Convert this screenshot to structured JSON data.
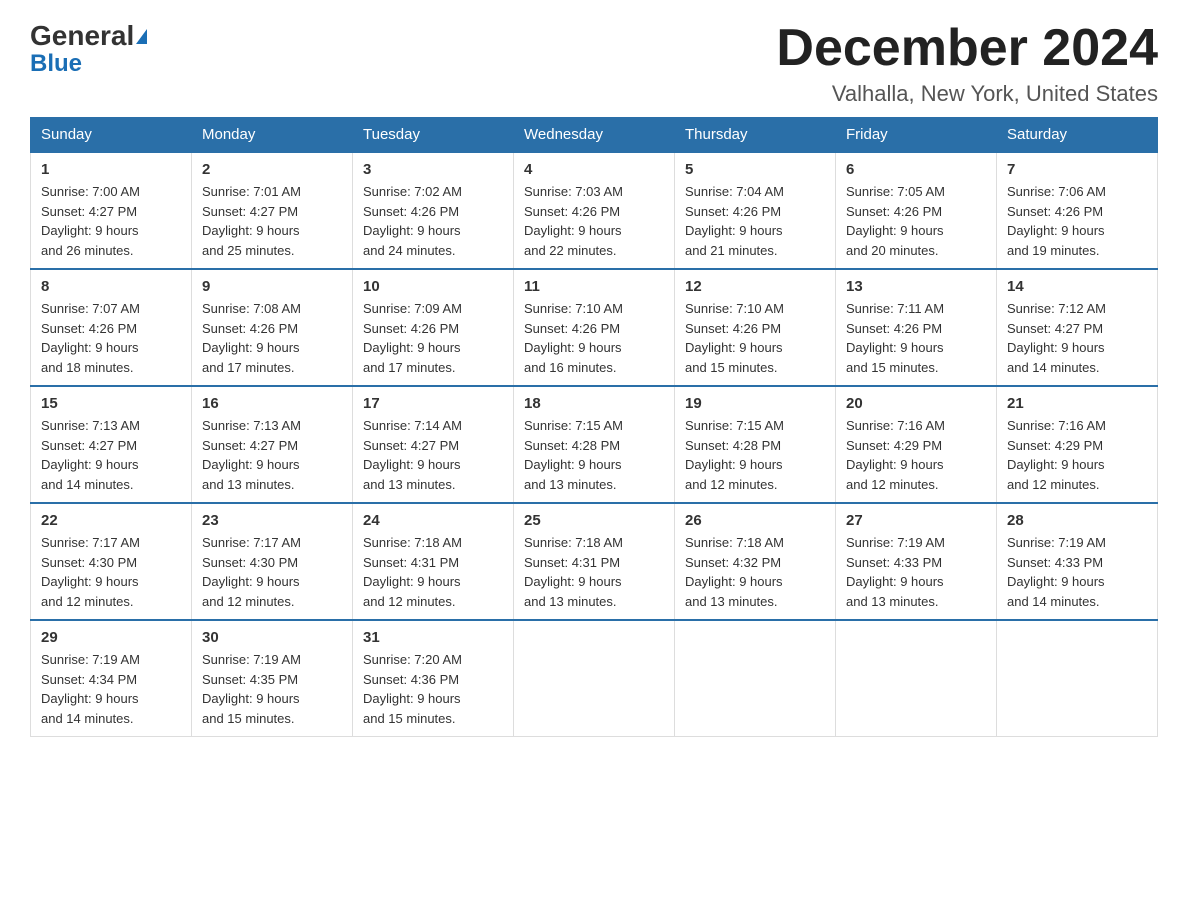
{
  "header": {
    "logo_line1": "General",
    "logo_line2": "Blue",
    "title": "December 2024",
    "subtitle": "Valhalla, New York, United States"
  },
  "calendar": {
    "days_of_week": [
      "Sunday",
      "Monday",
      "Tuesday",
      "Wednesday",
      "Thursday",
      "Friday",
      "Saturday"
    ],
    "weeks": [
      [
        {
          "day": "1",
          "sunrise": "7:00 AM",
          "sunset": "4:27 PM",
          "daylight": "9 hours and 26 minutes."
        },
        {
          "day": "2",
          "sunrise": "7:01 AM",
          "sunset": "4:27 PM",
          "daylight": "9 hours and 25 minutes."
        },
        {
          "day": "3",
          "sunrise": "7:02 AM",
          "sunset": "4:26 PM",
          "daylight": "9 hours and 24 minutes."
        },
        {
          "day": "4",
          "sunrise": "7:03 AM",
          "sunset": "4:26 PM",
          "daylight": "9 hours and 22 minutes."
        },
        {
          "day": "5",
          "sunrise": "7:04 AM",
          "sunset": "4:26 PM",
          "daylight": "9 hours and 21 minutes."
        },
        {
          "day": "6",
          "sunrise": "7:05 AM",
          "sunset": "4:26 PM",
          "daylight": "9 hours and 20 minutes."
        },
        {
          "day": "7",
          "sunrise": "7:06 AM",
          "sunset": "4:26 PM",
          "daylight": "9 hours and 19 minutes."
        }
      ],
      [
        {
          "day": "8",
          "sunrise": "7:07 AM",
          "sunset": "4:26 PM",
          "daylight": "9 hours and 18 minutes."
        },
        {
          "day": "9",
          "sunrise": "7:08 AM",
          "sunset": "4:26 PM",
          "daylight": "9 hours and 17 minutes."
        },
        {
          "day": "10",
          "sunrise": "7:09 AM",
          "sunset": "4:26 PM",
          "daylight": "9 hours and 17 minutes."
        },
        {
          "day": "11",
          "sunrise": "7:10 AM",
          "sunset": "4:26 PM",
          "daylight": "9 hours and 16 minutes."
        },
        {
          "day": "12",
          "sunrise": "7:10 AM",
          "sunset": "4:26 PM",
          "daylight": "9 hours and 15 minutes."
        },
        {
          "day": "13",
          "sunrise": "7:11 AM",
          "sunset": "4:26 PM",
          "daylight": "9 hours and 15 minutes."
        },
        {
          "day": "14",
          "sunrise": "7:12 AM",
          "sunset": "4:27 PM",
          "daylight": "9 hours and 14 minutes."
        }
      ],
      [
        {
          "day": "15",
          "sunrise": "7:13 AM",
          "sunset": "4:27 PM",
          "daylight": "9 hours and 14 minutes."
        },
        {
          "day": "16",
          "sunrise": "7:13 AM",
          "sunset": "4:27 PM",
          "daylight": "9 hours and 13 minutes."
        },
        {
          "day": "17",
          "sunrise": "7:14 AM",
          "sunset": "4:27 PM",
          "daylight": "9 hours and 13 minutes."
        },
        {
          "day": "18",
          "sunrise": "7:15 AM",
          "sunset": "4:28 PM",
          "daylight": "9 hours and 13 minutes."
        },
        {
          "day": "19",
          "sunrise": "7:15 AM",
          "sunset": "4:28 PM",
          "daylight": "9 hours and 12 minutes."
        },
        {
          "day": "20",
          "sunrise": "7:16 AM",
          "sunset": "4:29 PM",
          "daylight": "9 hours and 12 minutes."
        },
        {
          "day": "21",
          "sunrise": "7:16 AM",
          "sunset": "4:29 PM",
          "daylight": "9 hours and 12 minutes."
        }
      ],
      [
        {
          "day": "22",
          "sunrise": "7:17 AM",
          "sunset": "4:30 PM",
          "daylight": "9 hours and 12 minutes."
        },
        {
          "day": "23",
          "sunrise": "7:17 AM",
          "sunset": "4:30 PM",
          "daylight": "9 hours and 12 minutes."
        },
        {
          "day": "24",
          "sunrise": "7:18 AM",
          "sunset": "4:31 PM",
          "daylight": "9 hours and 12 minutes."
        },
        {
          "day": "25",
          "sunrise": "7:18 AM",
          "sunset": "4:31 PM",
          "daylight": "9 hours and 13 minutes."
        },
        {
          "day": "26",
          "sunrise": "7:18 AM",
          "sunset": "4:32 PM",
          "daylight": "9 hours and 13 minutes."
        },
        {
          "day": "27",
          "sunrise": "7:19 AM",
          "sunset": "4:33 PM",
          "daylight": "9 hours and 13 minutes."
        },
        {
          "day": "28",
          "sunrise": "7:19 AM",
          "sunset": "4:33 PM",
          "daylight": "9 hours and 14 minutes."
        }
      ],
      [
        {
          "day": "29",
          "sunrise": "7:19 AM",
          "sunset": "4:34 PM",
          "daylight": "9 hours and 14 minutes."
        },
        {
          "day": "30",
          "sunrise": "7:19 AM",
          "sunset": "4:35 PM",
          "daylight": "9 hours and 15 minutes."
        },
        {
          "day": "31",
          "sunrise": "7:20 AM",
          "sunset": "4:36 PM",
          "daylight": "9 hours and 15 minutes."
        },
        null,
        null,
        null,
        null
      ]
    ],
    "labels": {
      "sunrise": "Sunrise: ",
      "sunset": "Sunset: ",
      "daylight": "Daylight: "
    }
  }
}
